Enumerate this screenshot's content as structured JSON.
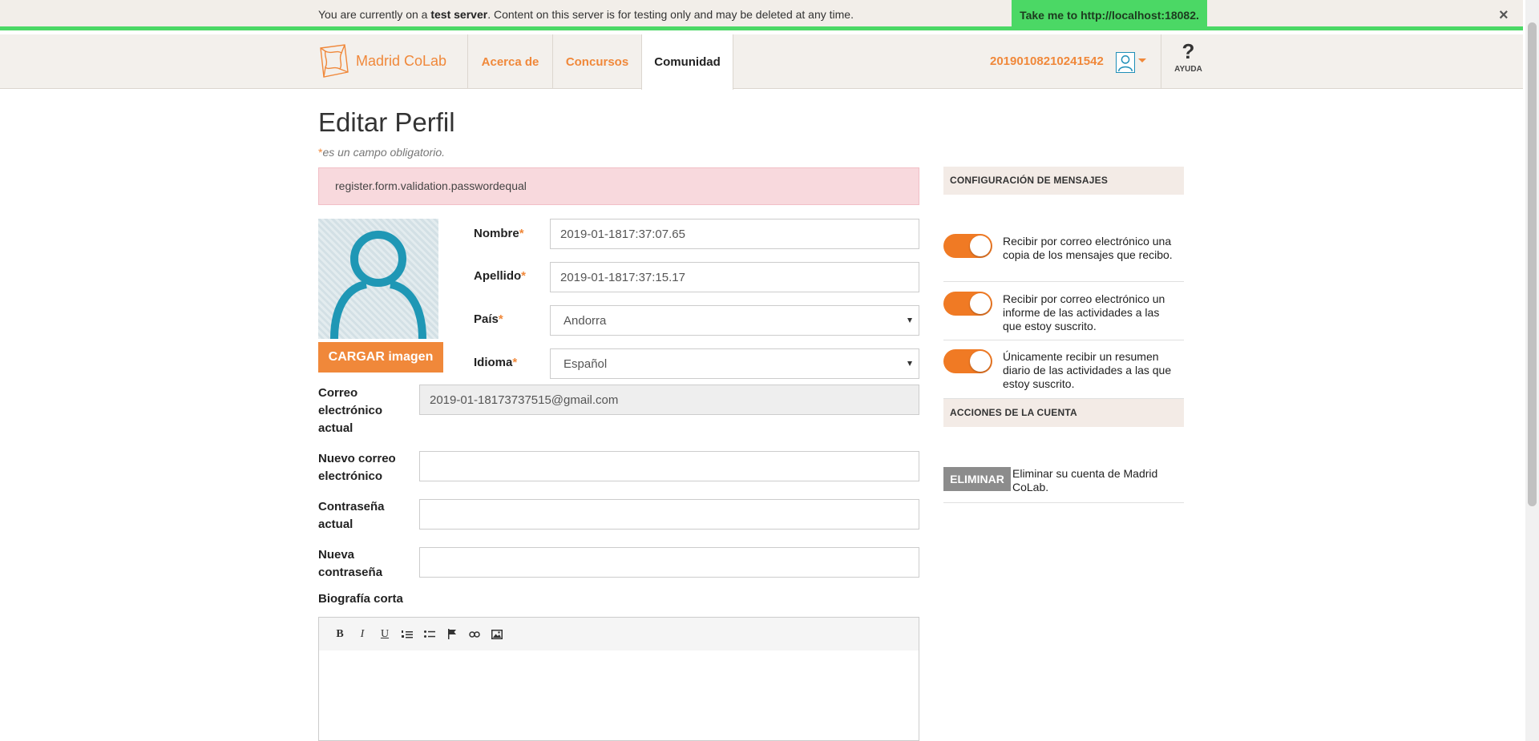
{
  "banner": {
    "text_before": "You are currently on a ",
    "text_bold": "test server",
    "text_after": ". Content on this server is for testing only and may be deleted at any time.",
    "button_label": "Take me to http://localhost:18082.",
    "close_label": "×"
  },
  "header": {
    "logo_text": "Madrid CoLab",
    "tabs": [
      {
        "label": "Acerca de"
      },
      {
        "label": "Concursos"
      },
      {
        "label": "Comunidad"
      }
    ],
    "user_name": "20190108210241542",
    "help_icon": "?",
    "help_label": "AYUDA"
  },
  "page": {
    "title": "Editar Perfil",
    "required_mark": "*",
    "required_note": "es un campo obligatorio.",
    "alert": "register.form.validation.passwordequal",
    "upload_label": "CARGAR imagen"
  },
  "form": {
    "nombre_label": "Nombre",
    "nombre_value": "2019-01-1817:37:07.65",
    "apellido_label": "Apellido",
    "apellido_value": "2019-01-1817:37:15.17",
    "pais_label": "País",
    "pais_value": "Andorra",
    "idioma_label": "Idioma",
    "idioma_value": "Español",
    "correo_actual_label_1": "Correo",
    "correo_actual_label_2": "electrónico",
    "correo_actual_label_3": "actual",
    "correo_actual_value": "2019-01-18173737515@gmail.com",
    "nuevo_correo_label_1": "Nuevo correo",
    "nuevo_correo_label_2": "electrónico",
    "contrasena_actual_label_1": "Contraseña",
    "contrasena_actual_label_2": "actual",
    "nueva_contrasena_label_1": "Nueva",
    "nueva_contrasena_label_2": "contraseña",
    "biografia_label": "Biografía corta"
  },
  "editor": {
    "bold": "B",
    "italic": "I",
    "underline": "U"
  },
  "sidebar": {
    "messages_header": "CONFIGURACIÓN DE MENSAJES",
    "toggles": [
      {
        "text": "Recibir por correo electrónico una copia de los mensajes que recibo.",
        "on": true
      },
      {
        "text": "Recibir por correo electrónico un informe de las actividades a las que estoy suscrito.",
        "on": true
      },
      {
        "text": "Únicamente recibir un resumen diario de las actividades a las que estoy suscrito.",
        "on": true
      }
    ],
    "account_header": "ACCIONES DE LA CUENTA",
    "delete_label": "ELIMINAR",
    "delete_text": "Eliminar su cuenta de Madrid CoLab."
  },
  "colors": {
    "accent": "#f0883a",
    "banner_green": "#4bd865",
    "alert_bg": "#f8d9dd"
  }
}
